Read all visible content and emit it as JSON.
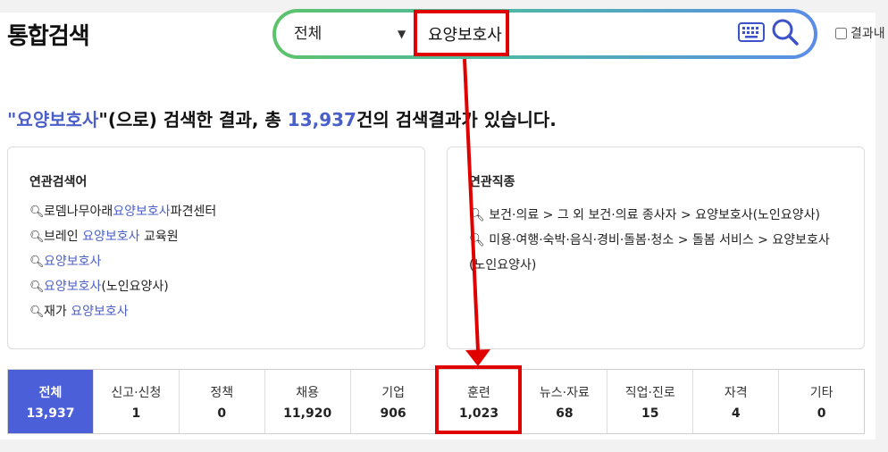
{
  "header": {
    "title": "통합검색",
    "scope_value": "전체",
    "search_value": "요양보호사",
    "within_results_label": "결과내"
  },
  "summary": {
    "open_quote": "\"",
    "keyword": "요양보호사",
    "text1": "\"(으로) 검색한 결과, 총 ",
    "total": "13,937",
    "text2": "건의 검색결과가 있습니다."
  },
  "related_keywords": {
    "title": "연관검색어",
    "items": [
      {
        "pre": "로뎀나무아래",
        "hl": "요양보호사",
        "post": "파견센터"
      },
      {
        "pre": "브레인 ",
        "hl": "요양보호사",
        "post": " 교육원"
      },
      {
        "pre": "",
        "hl": "요양보호사",
        "post": ""
      },
      {
        "pre": "",
        "hl": "요양보호사",
        "post": "(노인요양사)"
      },
      {
        "pre": "재가 ",
        "hl": "요양보호사",
        "post": ""
      }
    ]
  },
  "related_occupations": {
    "title": "연관직종",
    "items": [
      "보건·의료 > 그 외 보건·의료 종사자 > 요양보호사(노인요양사)",
      "미용·여행·숙박·음식·경비·돌봄·청소 > 돌봄 서비스 > 요양보호사(노인요양사)"
    ]
  },
  "tabs": [
    {
      "label": "전체",
      "count": "13,937"
    },
    {
      "label": "신고·신청",
      "count": "1"
    },
    {
      "label": "정책",
      "count": "0"
    },
    {
      "label": "채용",
      "count": "11,920"
    },
    {
      "label": "기업",
      "count": "906"
    },
    {
      "label": "훈련",
      "count": "1,023"
    },
    {
      "label": "뉴스·자료",
      "count": "68"
    },
    {
      "label": "직업·진로",
      "count": "15"
    },
    {
      "label": "자격",
      "count": "4"
    },
    {
      "label": "기타",
      "count": "0"
    }
  ],
  "colors": {
    "accent": "#4b5fd9",
    "highlight_text": "#4b5fc8",
    "annotation": "#e00000",
    "search_gradient": [
      "#5cc36b",
      "#5b8de8"
    ]
  },
  "icons": {
    "dropdown": "chevron-down-icon",
    "keyboard": "keyboard-icon",
    "search": "search-icon",
    "bullet": "magnifier-icon"
  }
}
